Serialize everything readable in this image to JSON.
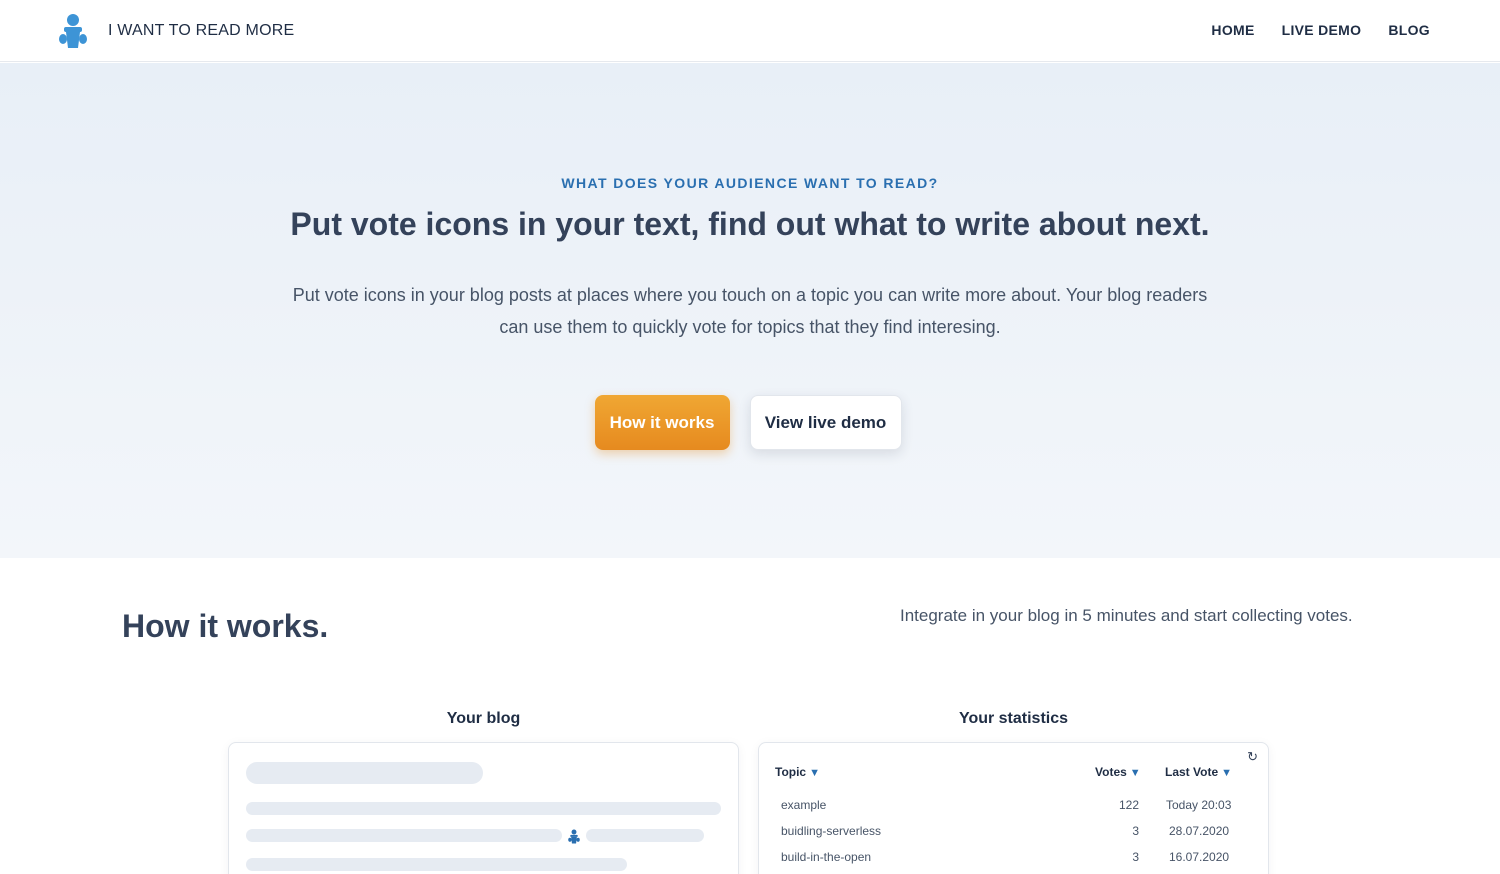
{
  "header": {
    "brand_title": "I WANT TO READ MORE",
    "logo_icon": "reader-person-icon",
    "nav": [
      {
        "label": "HOME"
      },
      {
        "label": "LIVE DEMO"
      },
      {
        "label": "BLOG"
      }
    ]
  },
  "hero": {
    "eyebrow": "WHAT DOES YOUR AUDIENCE WANT TO READ?",
    "headline": "Put vote icons in your text, find out what to write about next.",
    "lead": "Put vote icons in your blog posts at places where you touch on a topic you can write more about. Your blog readers can use them to quickly vote for topics that they find interesing.",
    "primary_button": "How it works",
    "secondary_button": "View live demo"
  },
  "how_it_works": {
    "title": "How it works.",
    "subtitle": "Integrate in your blog in 5 minutes and start collecting votes.",
    "blog_card_label": "Your blog",
    "stats_card_label": "Your statistics",
    "stats_columns": {
      "topic": "Topic",
      "votes": "Votes",
      "last_vote": "Last Vote",
      "sort_icon": "sort-down-icon",
      "refresh_icon": "refresh-icon"
    },
    "stats_rows": [
      {
        "topic": "example",
        "votes": "122",
        "last_vote": "Today 20:03"
      },
      {
        "topic": "buidling-serverless",
        "votes": "3",
        "last_vote": "28.07.2020"
      },
      {
        "topic": "build-in-the-open",
        "votes": "3",
        "last_vote": "16.07.2020"
      }
    ]
  },
  "colors": {
    "accent_blue": "#2a6fb0",
    "logo_blue": "#3d94d6",
    "button_orange": "#ee9c2c",
    "text_dark": "#34425a"
  }
}
